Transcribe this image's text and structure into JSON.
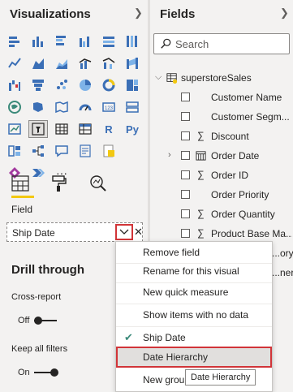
{
  "viz": {
    "title": "Visualizations",
    "collapse_icon": "chevron-right",
    "more": "···",
    "r_glyph": "R",
    "py_glyph": "Py",
    "tabs": [
      "fields-tab",
      "format-tab",
      "analytics-tab"
    ],
    "field_label": "Field",
    "field_value": "Ship Date",
    "drill_title": "Drill through",
    "cross_report_label": "Cross-report",
    "cross_report_value": "Off",
    "keep_filters_label": "Keep all filters",
    "keep_filters_value": "On"
  },
  "fields": {
    "title": "Fields",
    "search_placeholder": "Search",
    "table_name": "superstoreSales",
    "items": [
      {
        "label": "Customer Name",
        "kind": "text"
      },
      {
        "label": "Customer Segm...",
        "kind": "text"
      },
      {
        "label": "Discount",
        "kind": "sum"
      },
      {
        "label": "Order Date",
        "kind": "date"
      },
      {
        "label": "Order ID",
        "kind": "sum"
      },
      {
        "label": "Order Priority",
        "kind": "text"
      },
      {
        "label": "Order Quantity",
        "kind": "sum"
      },
      {
        "label": "Product Base Ma...",
        "kind": "sum"
      },
      {
        "label": "...ory",
        "kind": "partial"
      },
      {
        "label": "...ner",
        "kind": "partial"
      }
    ]
  },
  "menu": {
    "items": [
      "Remove field",
      "Rename for this visual",
      "New quick measure",
      "Show items with no data",
      "Ship Date",
      "Date Hierarchy",
      "New grou"
    ]
  },
  "tooltip": "Date Hierarchy",
  "colors": {
    "accent_yellow": "#f2c811",
    "highlight_red": "#d13438",
    "check_green": "#3b8a7a"
  }
}
